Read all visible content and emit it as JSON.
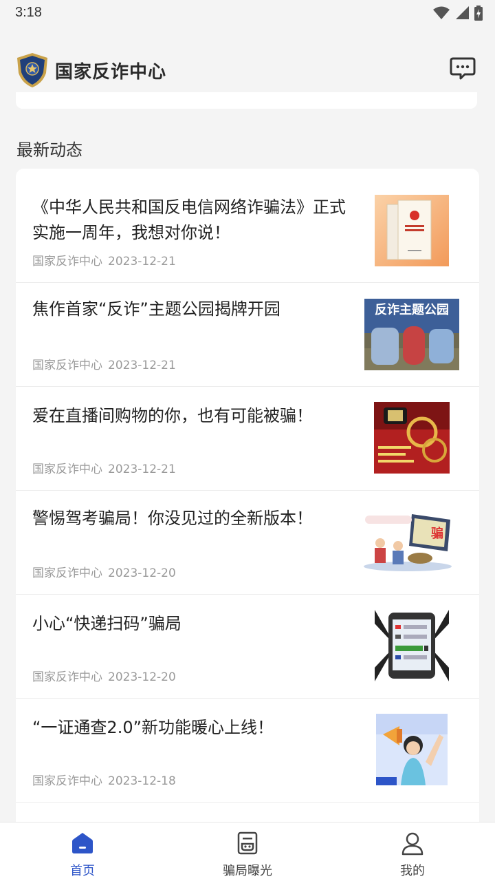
{
  "status": {
    "time": "3:18"
  },
  "header": {
    "title": "国家反诈中心",
    "logo_icon": "police-badge-icon",
    "message_icon": "chat-icon"
  },
  "section": {
    "title": "最新动态"
  },
  "news": [
    {
      "title": "《中华人民共和国反电信网络诈骗法》正式实施一周年，我想对你说！",
      "source": "国家反诈中心",
      "date": "2023-12-21"
    },
    {
      "title": "焦作首家“反诈”主题公园揭牌开园",
      "source": "国家反诈中心",
      "date": "2023-12-21",
      "thumb_text": "反诈主题公园"
    },
    {
      "title": "爱在直播间购物的你，也有可能被骗！",
      "source": "国家反诈中心",
      "date": "2023-12-21"
    },
    {
      "title": "警惕驾考骗局！你没见过的全新版本！",
      "source": "国家反诈中心",
      "date": "2023-12-20",
      "thumb_text": "骗"
    },
    {
      "title": "小心“快递扫码”骗局",
      "source": "国家反诈中心",
      "date": "2023-12-20"
    },
    {
      "title": "“一证通查2.0”新功能暖心上线！",
      "source": "国家反诈中心",
      "date": "2023-12-18"
    }
  ],
  "nav": [
    {
      "label": "首页",
      "icon": "home-icon",
      "active": true
    },
    {
      "label": "骗局曝光",
      "icon": "exposure-icon",
      "active": false
    },
    {
      "label": "我的",
      "icon": "user-icon",
      "active": false
    }
  ],
  "colors": {
    "accent": "#2d55c8",
    "background": "#f4f4f4",
    "meta": "#9a9a9a"
  }
}
